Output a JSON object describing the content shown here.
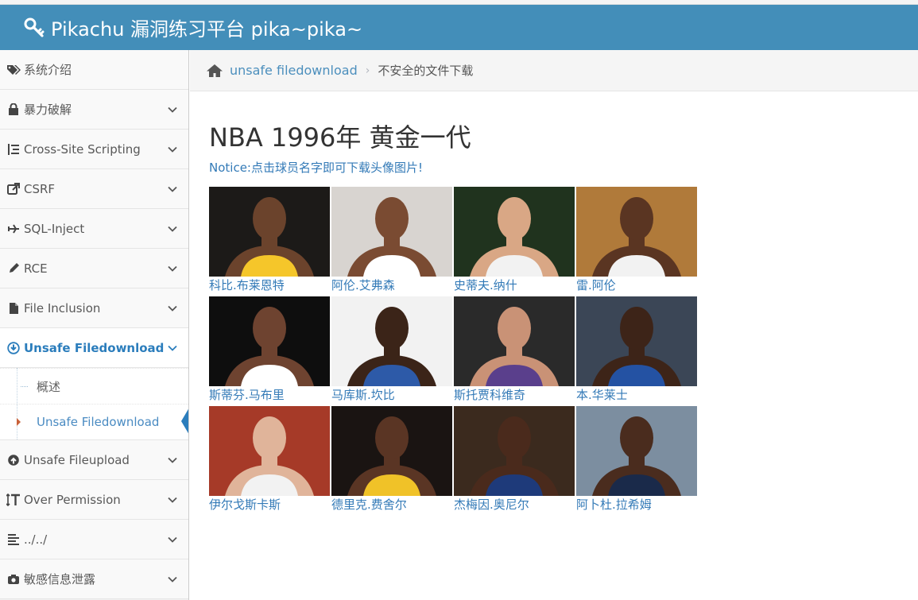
{
  "brand": {
    "title": "Pikachu 漏洞练习平台 pika~pika~",
    "icon": "key-icon"
  },
  "sidebar": {
    "items": [
      {
        "label": "系统介绍",
        "icon": "tags-icon",
        "has_arrow": false
      },
      {
        "label": "暴力破解",
        "icon": "lock-icon",
        "has_arrow": true
      },
      {
        "label": "Cross-Site Scripting",
        "icon": "list-icon",
        "has_arrow": true
      },
      {
        "label": "CSRF",
        "icon": "share-icon",
        "has_arrow": true
      },
      {
        "label": "SQL-Inject",
        "icon": "plane-icon",
        "has_arrow": true
      },
      {
        "label": "RCE",
        "icon": "pencil-icon",
        "has_arrow": true
      },
      {
        "label": "File Inclusion",
        "icon": "file-icon",
        "has_arrow": true
      },
      {
        "label": "Unsafe Filedownload",
        "icon": "download-circle-icon",
        "has_arrow": true,
        "open": true
      },
      {
        "label": "Unsafe Fileupload",
        "icon": "upload-circle-icon",
        "has_arrow": true
      },
      {
        "label": "Over Permission",
        "icon": "text-height-icon",
        "has_arrow": true
      },
      {
        "label": "../../",
        "icon": "align-left-icon",
        "has_arrow": true
      },
      {
        "label": "敏感信息泄露",
        "icon": "camera-icon",
        "has_arrow": true
      }
    ],
    "submenu": [
      {
        "label": "概述"
      },
      {
        "label": "Unsafe Filedownload",
        "active": true
      }
    ]
  },
  "breadcrumbs": {
    "link": "unsafe filedownload",
    "current": "不安全的文件下载"
  },
  "main": {
    "title": "NBA 1996年 黄金一代",
    "notice": "Notice:点击球员名字即可下载头像图片!"
  },
  "players": [
    {
      "name": "科比.布莱恩特",
      "bg": "#1c1a18",
      "jersey": "#f5c62a",
      "skin": "#6b432c"
    },
    {
      "name": "阿伦.艾弗森",
      "bg": "#d8d4d0",
      "jersey": "#ffffff",
      "skin": "#7a4b32"
    },
    {
      "name": "史蒂夫.纳什",
      "bg": "#20331e",
      "jersey": "#f2f2f2",
      "skin": "#d9a785"
    },
    {
      "name": "雷.阿伦",
      "bg": "#b07a3a",
      "jersey": "#f2f2f2",
      "skin": "#5a3522"
    },
    {
      "name": "斯蒂芬.马布里",
      "bg": "#0e0e0e",
      "jersey": "#ffffff",
      "skin": "#6e4330"
    },
    {
      "name": "马库斯.坎比",
      "bg": "#f2f2f2",
      "jersey": "#2d5aa8",
      "skin": "#3b2418"
    },
    {
      "name": "斯托贾科维奇",
      "bg": "#2a2a2a",
      "jersey": "#5a3f8c",
      "skin": "#c99276"
    },
    {
      "name": "本.华莱士",
      "bg": "#3b4656",
      "jersey": "#2452a3",
      "skin": "#3d2418"
    },
    {
      "name": "伊尔戈斯卡斯",
      "bg": "#a63a28",
      "jersey": "#f2f2f2",
      "skin": "#e0b49a"
    },
    {
      "name": "德里克.费舍尔",
      "bg": "#1a1412",
      "jersey": "#f0c228",
      "skin": "#5a3524"
    },
    {
      "name": "杰梅因.奥尼尔",
      "bg": "#3b2a1e",
      "jersey": "#1e3a7a",
      "skin": "#4a2a1c"
    },
    {
      "name": "阿卜杜.拉希姆",
      "bg": "#7c8ea0",
      "jersey": "#1a2a4a",
      "skin": "#4a2c1e"
    }
  ]
}
